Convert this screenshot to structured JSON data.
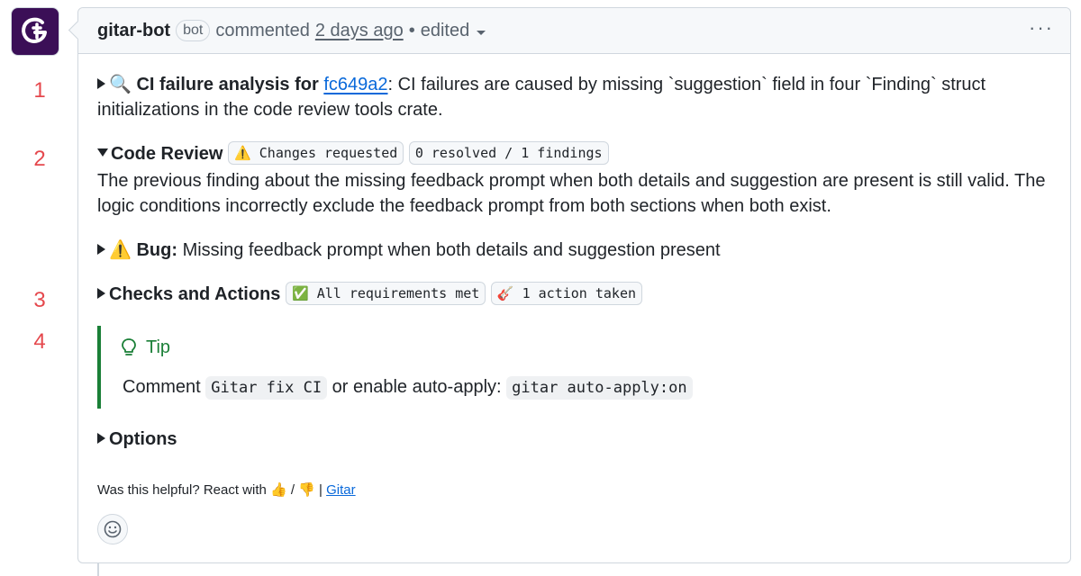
{
  "annotations": [
    "1",
    "2",
    "3",
    "4"
  ],
  "header": {
    "author": "gitar-bot",
    "bot_label": "bot",
    "action": "commented",
    "timestamp": "2 days ago",
    "separator": "•",
    "edited": "edited",
    "more_menu": "···"
  },
  "ci": {
    "icon": "🔍",
    "title": "CI failure analysis for",
    "commit": "fc649a2",
    "text_line1": ": CI failures are caused by missing `suggestion` field in four `Finding` struct",
    "text_line2": "initializations in the code review tools crate."
  },
  "code_review": {
    "title": "Code Review",
    "badge_status": "⚠️ Changes requested",
    "badge_findings": "0 resolved / 1 findings",
    "description": "The previous finding about the missing feedback prompt when both details and suggestion are present is still valid. The logic conditions incorrectly exclude the feedback prompt from both sections when both exist."
  },
  "bug": {
    "icon": "⚠️",
    "label": "Bug:",
    "text": "Missing feedback prompt when both details and suggestion present"
  },
  "checks": {
    "title": "Checks and Actions",
    "badge_requirements": "✅ All requirements met",
    "badge_actions": "🎸 1 action taken"
  },
  "tip": {
    "title": "Tip",
    "text_before": "Comment",
    "code1": "Gitar fix CI",
    "text_middle": "or enable auto-apply:",
    "code2": "gitar auto-apply:on"
  },
  "options": {
    "title": "Options"
  },
  "footer": {
    "text": "Was this helpful? React with 👍 / 👎 |",
    "link": "Gitar"
  },
  "colors": {
    "link": "#0969da",
    "tip_green": "#1a7f37",
    "annotation_red": "#e5484d",
    "avatar_bg": "#3b0f57"
  }
}
